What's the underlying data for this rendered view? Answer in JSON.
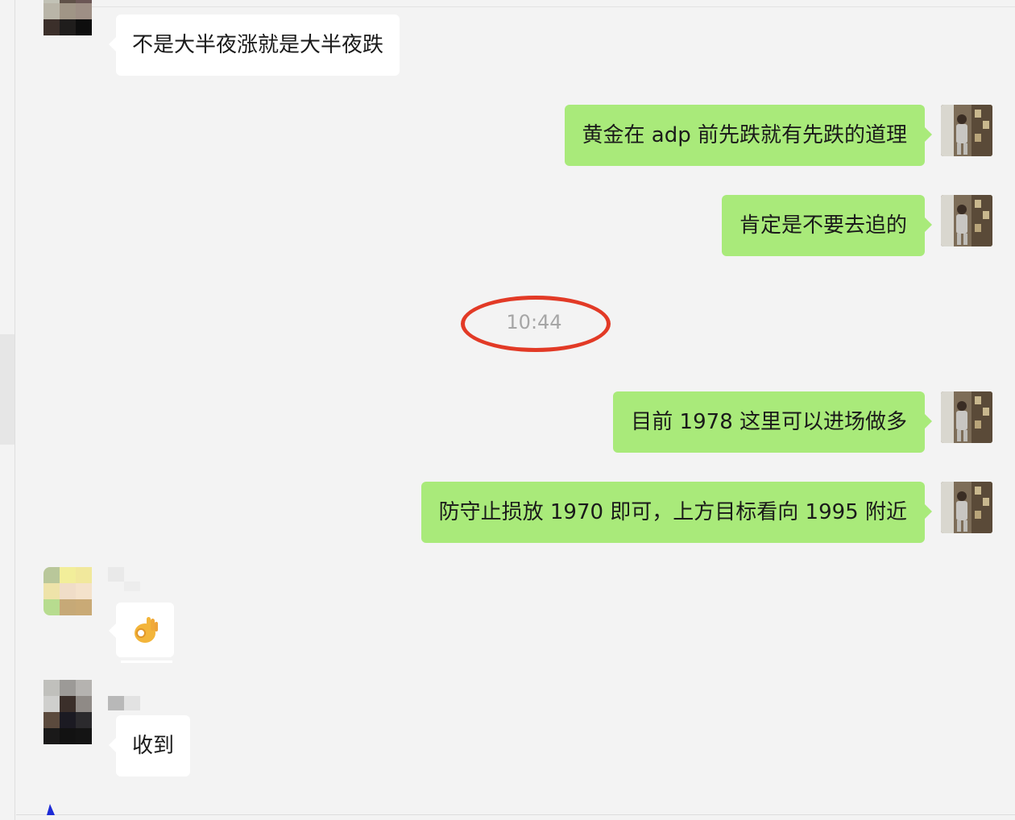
{
  "chat": {
    "messages": [
      {
        "side": "incoming",
        "text": "不是大半夜涨就是大半夜跌"
      },
      {
        "side": "outgoing",
        "text": "黄金在 adp 前先跌就有先跌的道理"
      },
      {
        "side": "outgoing",
        "text": "肯定是不要去追的"
      },
      {
        "side": "outgoing",
        "text": "目前 1978 这里可以进场做多"
      },
      {
        "side": "outgoing",
        "text": "防守止损放 1970 即可，上方目标看向 1995 附近"
      },
      {
        "side": "incoming",
        "emoji": "ok-hand-emoji"
      },
      {
        "side": "incoming",
        "text": "收到"
      }
    ],
    "timestamp": "10:44",
    "highlight_color": "#e23a26",
    "bubble_out_color": "#a9ea7a",
    "bubble_in_color": "#ffffff"
  }
}
